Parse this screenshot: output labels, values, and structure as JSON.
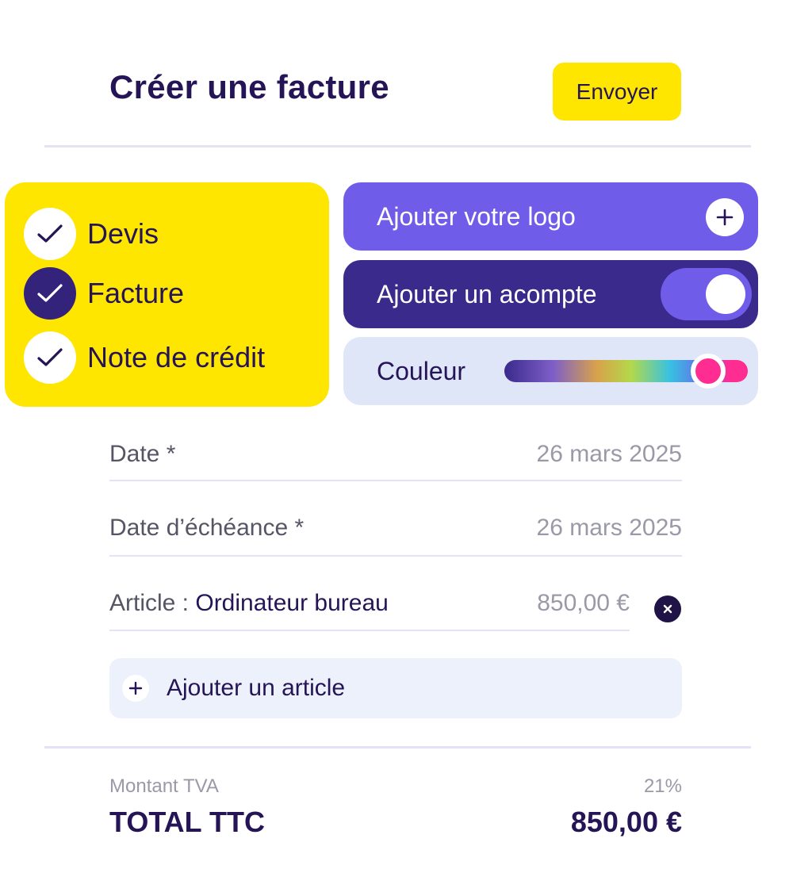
{
  "header": {
    "title": "Créer une facture",
    "send_label": "Envoyer"
  },
  "document_types": {
    "items": [
      {
        "label": "Devis",
        "selected": false
      },
      {
        "label": "Facture",
        "selected": true
      },
      {
        "label": "Note de crédit",
        "selected": false
      }
    ]
  },
  "options": {
    "logo_label": "Ajouter votre logo",
    "deposit_label": "Ajouter un acompte",
    "deposit_enabled": true,
    "color_label": "Couleur",
    "selected_color": "#ff2d91"
  },
  "fields": {
    "date_label": "Date *",
    "date_value": "26 mars 2025",
    "due_label": "Date d’échéance *",
    "due_value": "26 mars 2025",
    "article_prefix": "Article : ",
    "article_name": "Ordinateur bureau",
    "article_price": "850,00 €"
  },
  "add_article_label": "Ajouter un article",
  "summary": {
    "vat_label": "Montant TVA",
    "vat_value": "21%",
    "total_label": "TOTAL TTC",
    "total_value": "850,00 €"
  },
  "colors": {
    "accent_yellow": "#ffe600",
    "accent_purple": "#6f5ce8",
    "dark_purple": "#3a2a8c",
    "pink": "#ff2d91"
  }
}
